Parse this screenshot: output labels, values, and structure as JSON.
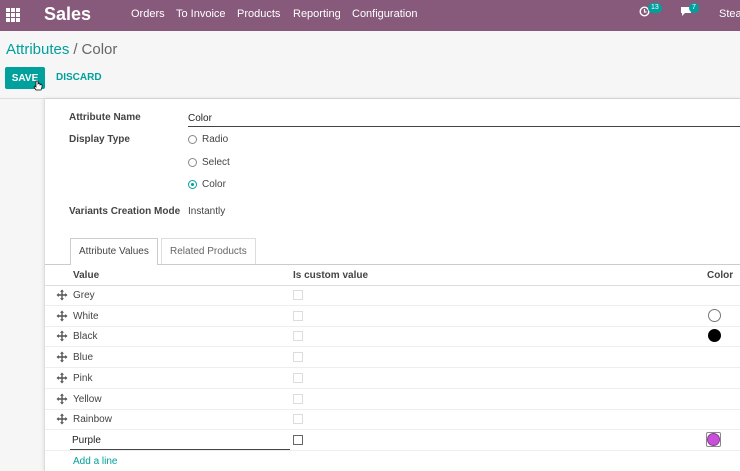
{
  "navbar": {
    "app_name": "Sales",
    "menu": [
      "Orders",
      "To Invoice",
      "Products",
      "Reporting",
      "Configuration"
    ],
    "activity_count": "13",
    "message_count": "7",
    "user": "Stea"
  },
  "breadcrumb": {
    "parent": "Attributes",
    "separator": "/",
    "current": "Color"
  },
  "actions": {
    "save": "SAVE",
    "discard": "DISCARD"
  },
  "form": {
    "attribute_name_label": "Attribute Name",
    "attribute_name_value": "Color",
    "display_type_label": "Display Type",
    "display_type_options": [
      "Radio",
      "Select",
      "Color"
    ],
    "display_type_selected": "Color",
    "variants_mode_label": "Variants Creation Mode",
    "variants_mode_value": "Instantly"
  },
  "tabs": [
    "Attribute Values",
    "Related Products"
  ],
  "table": {
    "headers": {
      "value": "Value",
      "custom": "Is custom value",
      "color": "Color"
    },
    "rows": [
      {
        "value": "Grey",
        "color": ""
      },
      {
        "value": "White",
        "color": "#ffffff"
      },
      {
        "value": "Black",
        "color": "#000000"
      },
      {
        "value": "Blue",
        "color": ""
      },
      {
        "value": "Pink",
        "color": ""
      },
      {
        "value": "Yellow",
        "color": ""
      },
      {
        "value": "Rainbow",
        "color": ""
      }
    ],
    "editing_row": {
      "value": "Purple",
      "color": "#c84fd8"
    },
    "add_line": "Add a line"
  },
  "colors": {
    "navbar": "#875a7b",
    "accent": "#00a09d"
  }
}
